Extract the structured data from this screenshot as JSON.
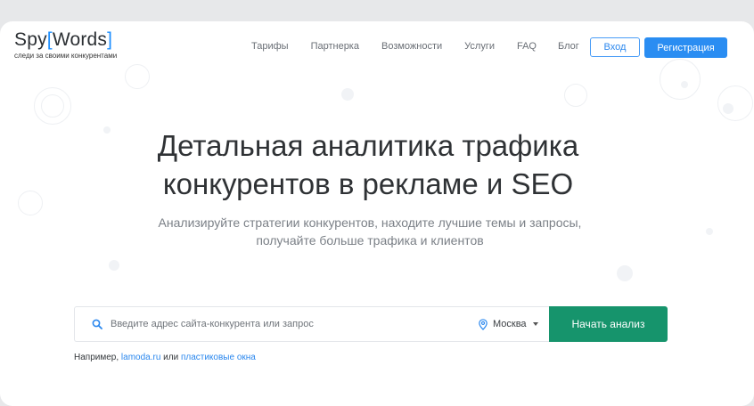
{
  "header": {
    "logo": {
      "name_part1": "Spy",
      "bracket_open": "[",
      "name_part2": "Words",
      "bracket_close": "]",
      "tagline": "следи за своими конкурентами"
    },
    "nav": [
      "Тарифы",
      "Партнерка",
      "Возможности",
      "Услуги",
      "FAQ",
      "Блог"
    ],
    "login_label": "Вход",
    "register_label": "Регистрация"
  },
  "hero": {
    "title_line1": "Детальная аналитика трафика",
    "title_line2": "конкурентов в рекламе и SEO",
    "subtitle_line1": "Анализируйте стратегии конкурентов, находите лучшие темы и запросы,",
    "subtitle_line2": "получайте больше трафика и клиентов"
  },
  "search": {
    "placeholder": "Введите адрес сайта-конкурента или запрос",
    "value": "",
    "region": "Москва",
    "button_label": "Начать анализ"
  },
  "examples": {
    "prefix": "Например,",
    "link1": "lamoda.ru",
    "separator": "или",
    "link2": "пластиковые окна"
  },
  "colors": {
    "accent_blue": "#2a8df2",
    "cta_green": "#16946c",
    "page_bg": "#e7e8ea"
  },
  "icons": [
    "search-icon",
    "location-pin-icon",
    "caret-down-icon"
  ]
}
